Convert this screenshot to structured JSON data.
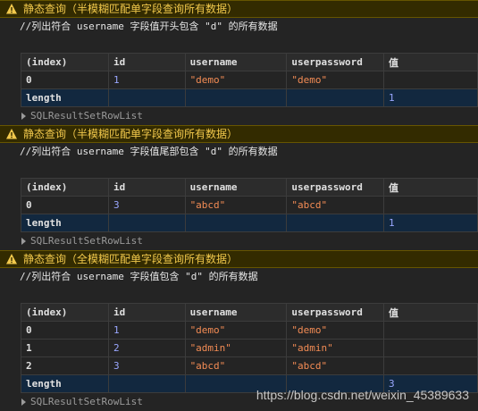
{
  "blocks": [
    {
      "warning": "静态查询（半模糊匹配单字段查询所有数据）",
      "comment": "//列出符合 username 字段值开头包含 \"d\" 的所有数据",
      "columns": [
        "(index)",
        "id",
        "username",
        "userpassword",
        "值"
      ],
      "rows": [
        {
          "index": "0",
          "id": "1",
          "username": "\"demo\"",
          "userpassword": "\"demo\"",
          "value": ""
        }
      ],
      "length_row": {
        "index": "length",
        "value": "1"
      },
      "footer": "SQLResultSetRowList"
    },
    {
      "warning": "静态查询（半模糊匹配单字段查询所有数据）",
      "comment": "//列出符合 username 字段值尾部包含 \"d\" 的所有数据",
      "columns": [
        "(index)",
        "id",
        "username",
        "userpassword",
        "值"
      ],
      "rows": [
        {
          "index": "0",
          "id": "3",
          "username": "\"abcd\"",
          "userpassword": "\"abcd\"",
          "value": ""
        }
      ],
      "length_row": {
        "index": "length",
        "value": "1"
      },
      "footer": "SQLResultSetRowList"
    },
    {
      "warning": "静态查询（全模糊匹配单字段查询所有数据）",
      "comment": "//列出符合 username 字段值包含 \"d\" 的所有数据",
      "columns": [
        "(index)",
        "id",
        "username",
        "userpassword",
        "值"
      ],
      "rows": [
        {
          "index": "0",
          "id": "1",
          "username": "\"demo\"",
          "userpassword": "\"demo\"",
          "value": ""
        },
        {
          "index": "1",
          "id": "2",
          "username": "\"admin\"",
          "userpassword": "\"admin\"",
          "value": ""
        },
        {
          "index": "2",
          "id": "3",
          "username": "\"abcd\"",
          "userpassword": "\"abcd\"",
          "value": ""
        }
      ],
      "length_row": {
        "index": "length",
        "value": "3"
      },
      "footer": "SQLResultSetRowList"
    }
  ],
  "watermark": "https://blog.csdn.net/weixin_45389633",
  "colors": {
    "background": "#242424",
    "warning_bg": "#332b00",
    "warning_text": "#f2c94c",
    "number": "#9aa7ff",
    "string": "#f28b54",
    "length_row_bg": "#12283f"
  }
}
